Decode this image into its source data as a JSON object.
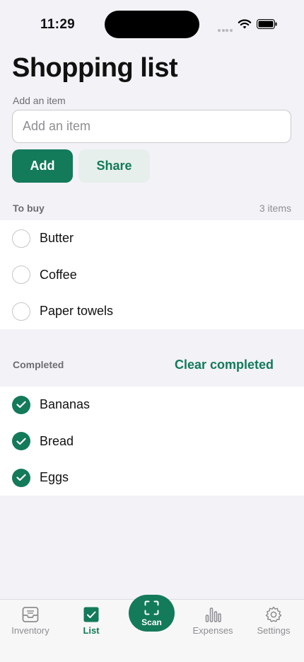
{
  "status": {
    "time": "11:29"
  },
  "title": "Shopping list",
  "add_item": {
    "label": "Add an item",
    "placeholder": "Add an item",
    "value": ""
  },
  "buttons": {
    "add": "Add",
    "share": "Share"
  },
  "to_buy": {
    "header": "To buy",
    "count": "3 items",
    "items": [
      {
        "label": "Butter",
        "checked": false
      },
      {
        "label": "Coffee",
        "checked": false
      },
      {
        "label": "Paper towels",
        "checked": false
      }
    ]
  },
  "completed": {
    "header": "Completed",
    "clear_label": "Clear completed",
    "items": [
      {
        "label": "Bananas",
        "checked": true
      },
      {
        "label": "Bread",
        "checked": true
      },
      {
        "label": "Eggs",
        "checked": true
      }
    ]
  },
  "tabs": [
    {
      "label": "Inventory",
      "icon": "tray-icon",
      "active": false
    },
    {
      "label": "List",
      "icon": "checkbox-icon",
      "active": true
    },
    {
      "label": "Scan",
      "icon": "scan-icon",
      "active": false
    },
    {
      "label": "Expenses",
      "icon": "bar-chart-icon",
      "active": false
    },
    {
      "label": "Settings",
      "icon": "gear-icon",
      "active": false
    }
  ],
  "colors": {
    "accent": "#137a5a",
    "accent_soft": "#e6efeb",
    "background": "#f2f2f7"
  }
}
